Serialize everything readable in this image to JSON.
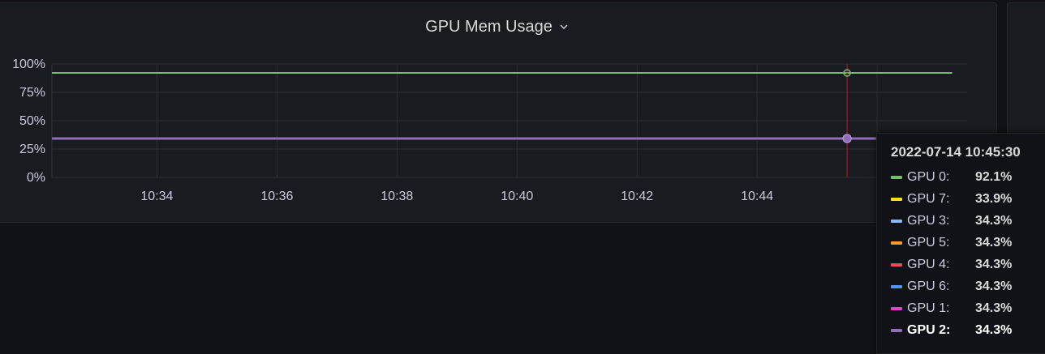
{
  "panel": {
    "title": "GPU Mem Usage"
  },
  "chart_data": {
    "type": "line",
    "title": "GPU Mem Usage",
    "x_range": [
      "10:32:15",
      "10:47:30"
    ],
    "x_ticks": [
      "10:34",
      "10:36",
      "10:38",
      "10:40",
      "10:42",
      "10:44"
    ],
    "y_ticks": [
      "0%",
      "25%",
      "50%",
      "75%",
      "100%"
    ],
    "ylim": [
      0,
      100
    ],
    "grid": true,
    "series": [
      {
        "name": "GPU 0",
        "color": "#73bf69",
        "x": [
          "10:32:15",
          "10:47:15"
        ],
        "values": [
          92.1,
          92.1
        ]
      },
      {
        "name": "GPU 7",
        "color": "#f2cc0c",
        "x": [
          "10:32:15",
          "10:47:15"
        ],
        "values": [
          33.9,
          33.9
        ]
      },
      {
        "name": "GPU 3",
        "color": "#8ab8ff",
        "x": [
          "10:32:15",
          "10:47:15"
        ],
        "values": [
          34.3,
          34.3
        ]
      },
      {
        "name": "GPU 5",
        "color": "#ff9830",
        "x": [
          "10:32:15",
          "10:47:15"
        ],
        "values": [
          34.3,
          34.3
        ]
      },
      {
        "name": "GPU 4",
        "color": "#f2495c",
        "x": [
          "10:32:15",
          "10:47:15"
        ],
        "values": [
          34.3,
          34.3
        ]
      },
      {
        "name": "GPU 6",
        "color": "#5794f2",
        "x": [
          "10:32:15",
          "10:47:15"
        ],
        "values": [
          34.3,
          34.3
        ]
      },
      {
        "name": "GPU 1",
        "color": "#b877d9",
        "x": [
          "10:32:15",
          "10:47:15"
        ],
        "values": [
          34.3,
          34.3
        ]
      },
      {
        "name": "GPU 2",
        "color": "#8f6db7",
        "x": [
          "10:32:15",
          "10:47:15"
        ],
        "values": [
          34.3,
          34.3
        ]
      }
    ],
    "cursor_x": "10:45:30"
  },
  "tooltip": {
    "time": "2022-07-14 10:45:30",
    "rows": [
      {
        "name": "GPU 0:",
        "value": "92.1%",
        "color": "#73bf69"
      },
      {
        "name": "GPU 7:",
        "value": "33.9%",
        "color": "#fade2a"
      },
      {
        "name": "GPU 3:",
        "value": "34.3%",
        "color": "#8ab8ff"
      },
      {
        "name": "GPU 5:",
        "value": "34.3%",
        "color": "#ff9830"
      },
      {
        "name": "GPU 4:",
        "value": "34.3%",
        "color": "#f2495c"
      },
      {
        "name": "GPU 6:",
        "value": "34.3%",
        "color": "#5794f2"
      },
      {
        "name": "GPU 1:",
        "value": "34.3%",
        "color": "#d44ac4"
      },
      {
        "name": "GPU 2:",
        "value": "34.3%",
        "color": "#8f6db7",
        "selected": true
      }
    ]
  }
}
